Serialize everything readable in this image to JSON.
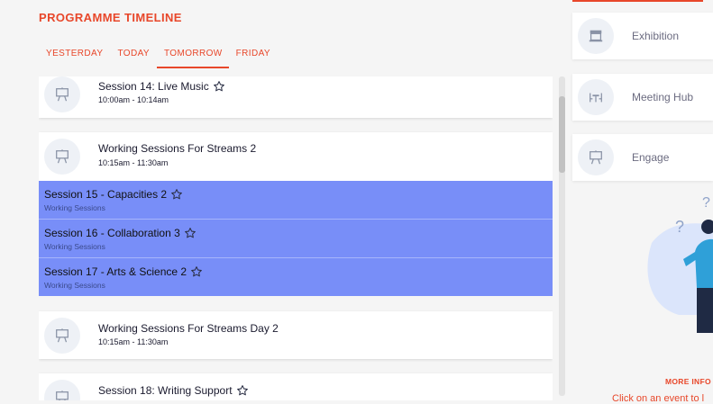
{
  "timeline": {
    "title": "PROGRAMME TIMELINE",
    "tabs": [
      {
        "label": "YESTERDAY"
      },
      {
        "label": "TODAY"
      },
      {
        "label": "TOMORROW",
        "active": true
      },
      {
        "label": "FRIDAY"
      }
    ],
    "sessions": [
      {
        "title": "Session 14: Live Music",
        "time": "10:00am - 10:14am"
      },
      {
        "title": "Working Sessions For Streams 2",
        "time": "10:15am - 11:30am"
      },
      {
        "title": "Working Sessions For Streams Day 2",
        "time": "10:15am - 11:30am"
      },
      {
        "title": "Session 18: Writing Support",
        "time": ""
      }
    ],
    "subsessions": [
      {
        "title": "Session 15 - Capacities 2",
        "subtitle": "Working Sessions"
      },
      {
        "title": "Session 16 - Collaboration 3",
        "subtitle": "Working Sessions"
      },
      {
        "title": "Session 17 - Arts & Science 2",
        "subtitle": "Working Sessions"
      }
    ]
  },
  "sidebar": {
    "nav": [
      {
        "label": "Exhibition",
        "icon": "booth-icon"
      },
      {
        "label": "Meeting Hub",
        "icon": "meeting-table-icon"
      },
      {
        "label": "Engage",
        "icon": "presentation-board-icon"
      }
    ],
    "more_info": "MORE INFO",
    "hint": "Click on an event to l"
  },
  "colors": {
    "accent": "#e8472a",
    "subsession_bg": "#788ef8",
    "card_bg": "#ffffff",
    "page_bg": "#f5f5f5"
  }
}
